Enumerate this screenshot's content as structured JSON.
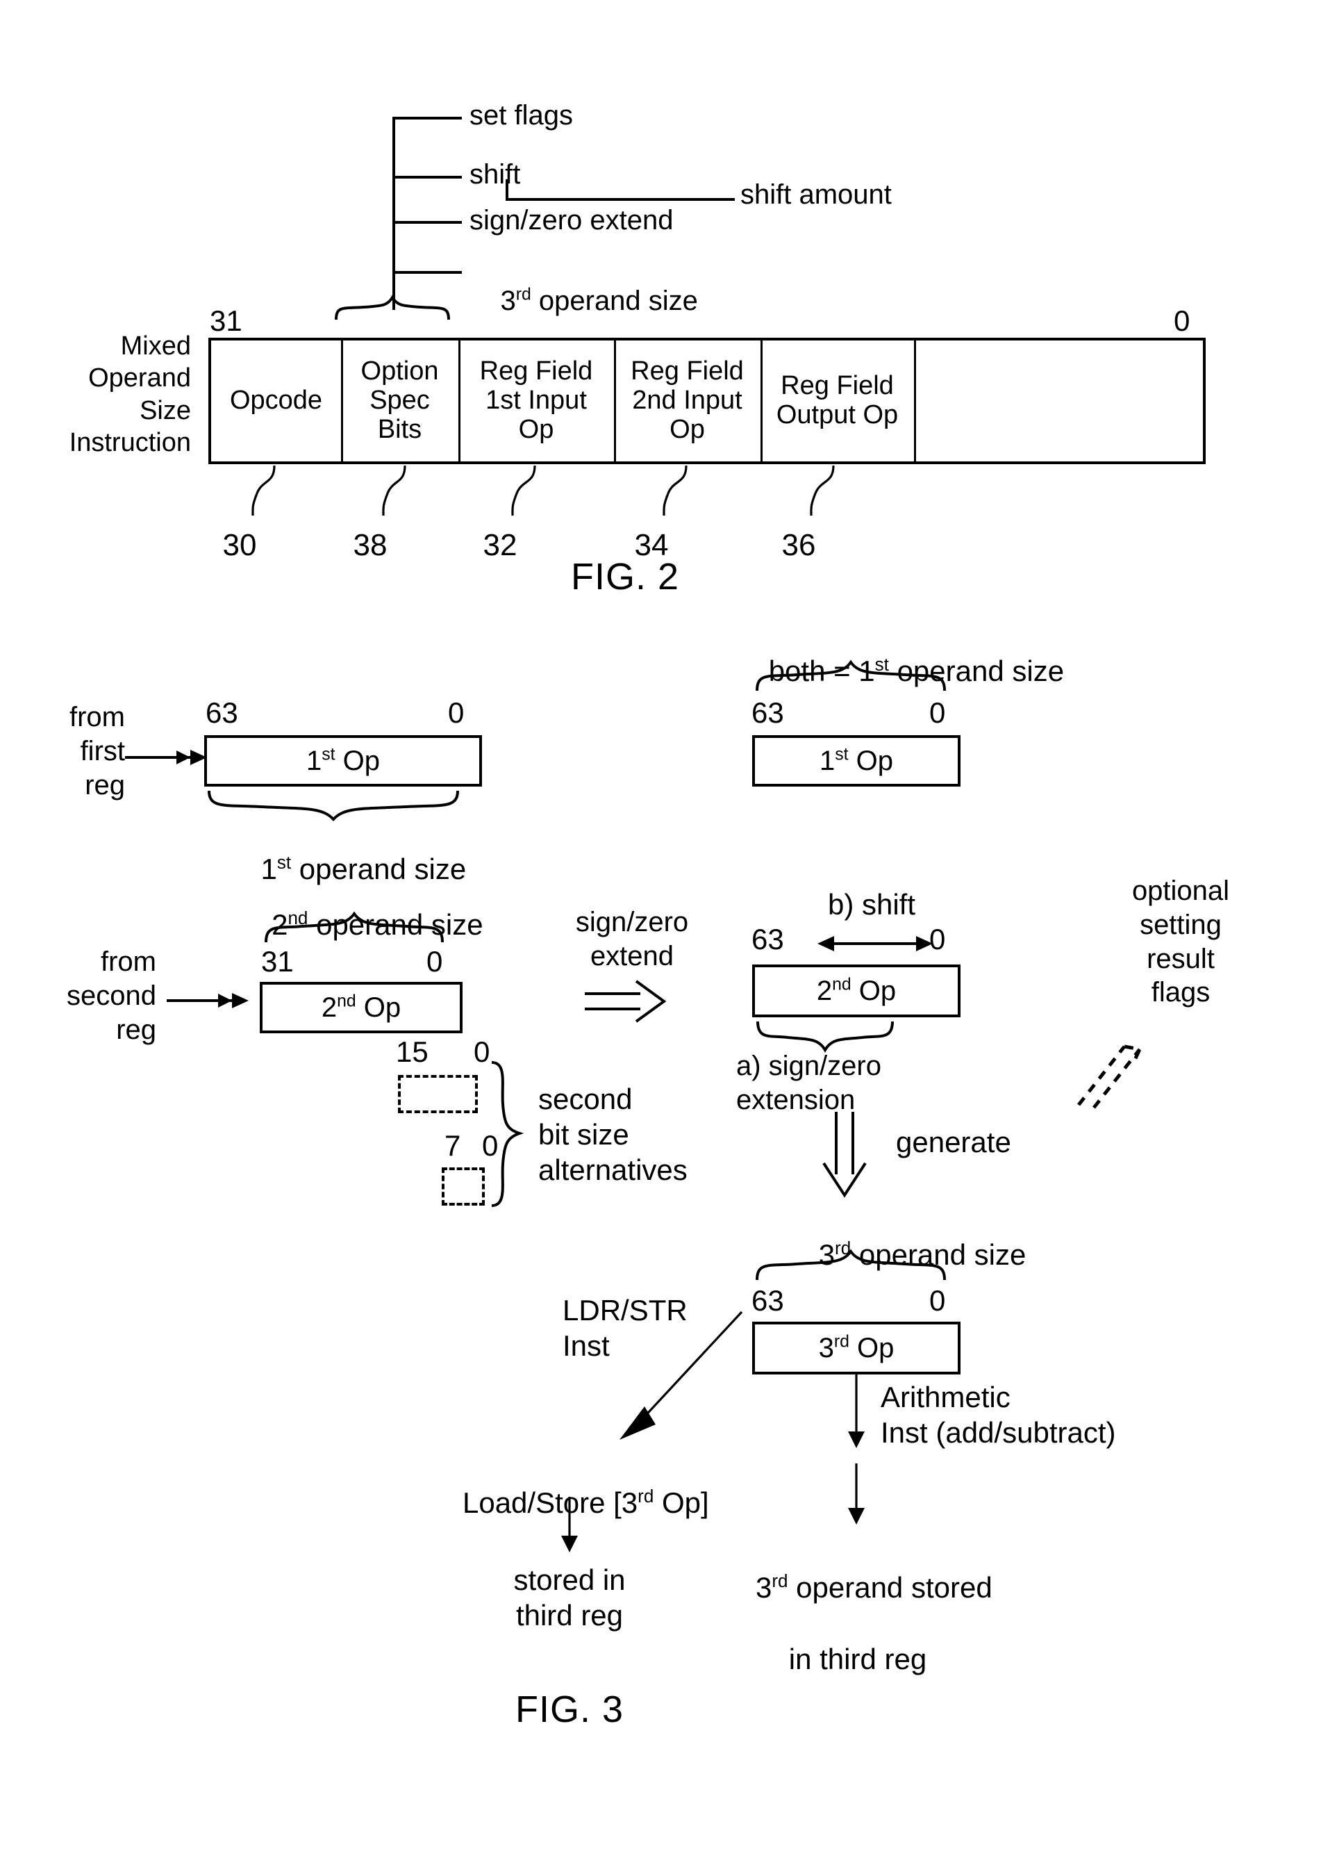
{
  "figure2": {
    "caption": "FIG. 2",
    "row_label": [
      "Mixed",
      "Operand",
      "Size",
      "Instruction"
    ],
    "bit_high": "31",
    "bit_low": "0",
    "option_callouts": [
      {
        "label": "set flags"
      },
      {
        "label": "shift"
      },
      {
        "label": "sign/zero extend"
      },
      {
        "label_pre": "3",
        "label_sup": "rd",
        "label_post": " operand size"
      }
    ],
    "shift_amount_label": "shift amount",
    "fields": [
      {
        "lines": [
          "Opcode"
        ],
        "ref": "30"
      },
      {
        "lines": [
          "Option",
          "Spec",
          "Bits"
        ],
        "ref": "38"
      },
      {
        "lines": [
          "Reg Field",
          "1st Input",
          "Op"
        ],
        "ref": "32"
      },
      {
        "lines": [
          "Reg Field",
          "2nd Input",
          "Op"
        ],
        "ref": "34"
      },
      {
        "lines": [
          "Reg Field",
          "Output Op"
        ],
        "ref": "36"
      },
      {
        "lines": [
          ""
        ],
        "ref": ""
      }
    ]
  },
  "figure3": {
    "caption": "FIG. 3",
    "first_operand": {
      "source_lines": [
        "from",
        "first",
        "reg"
      ],
      "bit_high": "63",
      "bit_low": "0",
      "box_label_pre": "1",
      "box_label_sup": "st",
      "box_label_post": " Op",
      "brace_label_pre": "1",
      "brace_label_sup": "st",
      "brace_label_post": " operand size"
    },
    "second_operand": {
      "source_lines": [
        "from",
        "second",
        "reg"
      ],
      "bit_high": "31",
      "bit_low": "0",
      "box_label_pre": "2",
      "box_label_sup": "nd",
      "box_label_post": " Op",
      "brace_label_pre": "2",
      "brace_label_sup": "nd",
      "brace_label_post": " operand size"
    },
    "transform_arrow_label": [
      "sign/zero",
      "extend"
    ],
    "result_first": {
      "brace_label_pre": "both = 1",
      "brace_label_sup": "st",
      "brace_label_post": " operand size",
      "bit_high": "63",
      "bit_low": "0",
      "box_label_pre": "1",
      "box_label_sup": "st",
      "box_label_post": " Op"
    },
    "result_second": {
      "shift_label": "b) shift",
      "bit_high": "63",
      "bit_low": "0",
      "box_label_pre": "2",
      "box_label_sup": "nd",
      "box_label_post": " Op",
      "extension_label": [
        "a) sign/zero",
        "extension"
      ]
    },
    "optional_flags_label": [
      "optional",
      "setting",
      "result",
      "flags"
    ],
    "alternatives": {
      "alt1_high": "15",
      "alt1_low": "0",
      "alt2_high": "7",
      "alt2_low": "0",
      "label": [
        "second",
        "bit size",
        "alternatives"
      ]
    },
    "generate_label": "generate",
    "third_operand": {
      "size_label_pre": "3",
      "size_label_sup": "rd",
      "size_label_post": " operand size",
      "bit_high": "63",
      "bit_low": "0",
      "box_label_pre": "3",
      "box_label_sup": "rd",
      "box_label_post": " Op"
    },
    "ldrstr_label": [
      "LDR/STR",
      "Inst"
    ],
    "loadstore_pre": "Load/Store [3",
    "loadstore_sup": "rd",
    "loadstore_post": " Op]",
    "stored_third_reg": [
      "stored in",
      "third reg"
    ],
    "arith_label": [
      "Arithmetic",
      "Inst (add/subtract)"
    ],
    "third_stored_pre": "3",
    "third_stored_sup": "rd",
    "third_stored_post": " operand stored",
    "third_stored_line2": "in third reg"
  }
}
